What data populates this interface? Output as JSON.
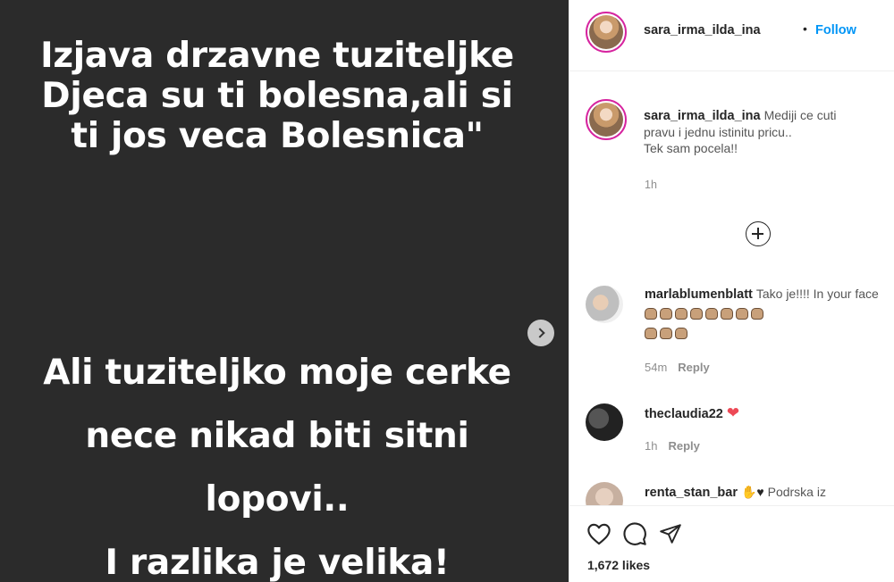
{
  "post": {
    "text_top": [
      "Izjava  drzavne tuziteljke",
      "Djeca su ti bolesna,ali si",
      "ti jos veca Bolesnica\""
    ],
    "text_bottom": [
      "Ali tuziteljko moje cerke",
      "nece nikad biti sitni",
      "lopovi..",
      "I razlika je velika!"
    ]
  },
  "header": {
    "username": "sara_irma_ilda_ina",
    "separator": "•",
    "follow_label": "Follow"
  },
  "caption": {
    "username": "sara_irma_ilda_ina",
    "line1": "Mediji ce cuti",
    "line2": "pravu i jednu istinitu pricu..",
    "line3": "Tek sam pocela!!",
    "time": "1h"
  },
  "comments": [
    {
      "username": "marlablumenblatt",
      "text": "Tako je!!!! In your face",
      "fist_count": 11,
      "time": "54m",
      "reply_label": "Reply"
    },
    {
      "username": "theclaudia22",
      "text": "",
      "emoji": "heart",
      "time": "1h",
      "reply_label": "Reply"
    },
    {
      "username": "renta_stan_bar",
      "text": "Podrska iz"
    }
  ],
  "colors": {
    "accent": "#0095f6",
    "heart": "#ed4956",
    "media_bg": "#2b2b2b"
  },
  "actions": {
    "like_icon": "heart-outline-icon",
    "comment_icon": "comment-icon",
    "share_icon": "paper-plane-icon"
  },
  "likes": "1,672 likes"
}
